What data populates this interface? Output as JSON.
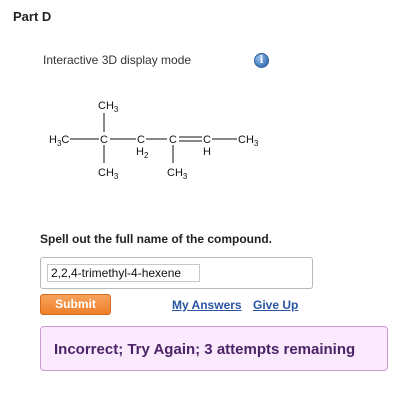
{
  "part": {
    "title": "Part D"
  },
  "display": {
    "mode_label": "Interactive 3D display mode",
    "info_glyph": "i"
  },
  "structure": {
    "ch3": "CH",
    "h3c": "H",
    "c": "C",
    "h": "H",
    "sub3": "3",
    "sub2": "2"
  },
  "question": {
    "prompt": "Spell out the full name of the compound."
  },
  "answer": {
    "value": "2,2,4-trimethyl-4-hexene"
  },
  "actions": {
    "submit_label": "Submit",
    "my_answers_label": "My Answers",
    "give_up_label": "Give Up"
  },
  "feedback": {
    "message": "Incorrect; Try Again; 3 attempts remaining",
    "bg_color": "#fbe9fd",
    "text_color": "#4b2467"
  },
  "colors": {
    "submit": "#ee7f2a",
    "link": "#2a55a4"
  }
}
